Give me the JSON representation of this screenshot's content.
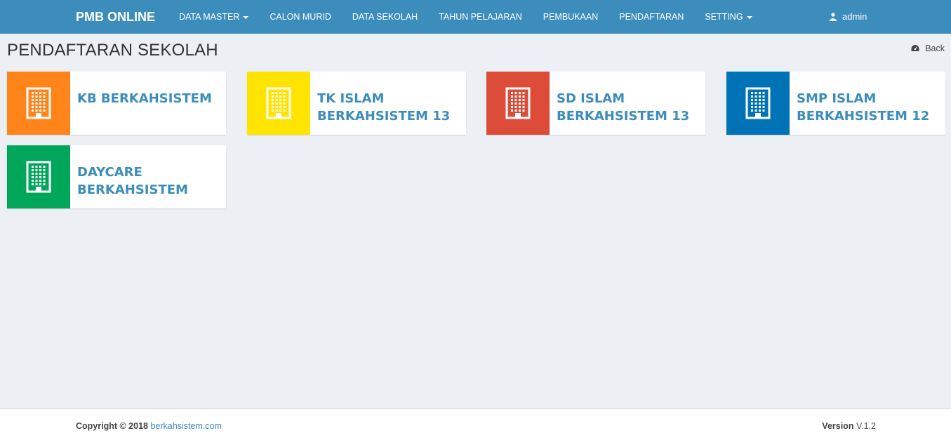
{
  "navbar": {
    "brand": "PMB ONLINE",
    "items": [
      {
        "label": "DATA MASTER",
        "dropdown": true
      },
      {
        "label": "CALON MURID",
        "dropdown": false
      },
      {
        "label": "DATA SEKOLAH",
        "dropdown": false
      },
      {
        "label": "TAHUN PELAJARAN",
        "dropdown": false
      },
      {
        "label": "PEMBUKAAN",
        "dropdown": false
      },
      {
        "label": "PENDAFTARAN",
        "dropdown": false
      },
      {
        "label": "SETTING",
        "dropdown": true
      }
    ],
    "user": "admin",
    "user_icon": "user-icon",
    "color": "#3c8dbc"
  },
  "page": {
    "title": "PENDAFTARAN SEKOLAH",
    "back_label": "Back",
    "back_icon": "dashboard-icon"
  },
  "schools": [
    {
      "name": "KB BERKAHSISTEM",
      "color": "#ff851b",
      "icon": "building-icon"
    },
    {
      "name": "TK ISLAM BERKAHSISTEM 13",
      "color": "#ffe400",
      "icon": "building-icon"
    },
    {
      "name": "SD ISLAM BERKAHSISTEM 13",
      "color": "#dd4b39",
      "icon": "building-icon"
    },
    {
      "name": "SMP ISLAM BERKAHSISTEM 12",
      "color": "#0073b7",
      "icon": "building-icon"
    },
    {
      "name": "DAYCARE BERKAHSISTEM",
      "color": "#00a65a",
      "icon": "building-icon"
    }
  ],
  "footer": {
    "copyright": "Copyright © 2018",
    "link": "berkahsistem.com",
    "version_label": "Version",
    "version": "V.1.2"
  }
}
